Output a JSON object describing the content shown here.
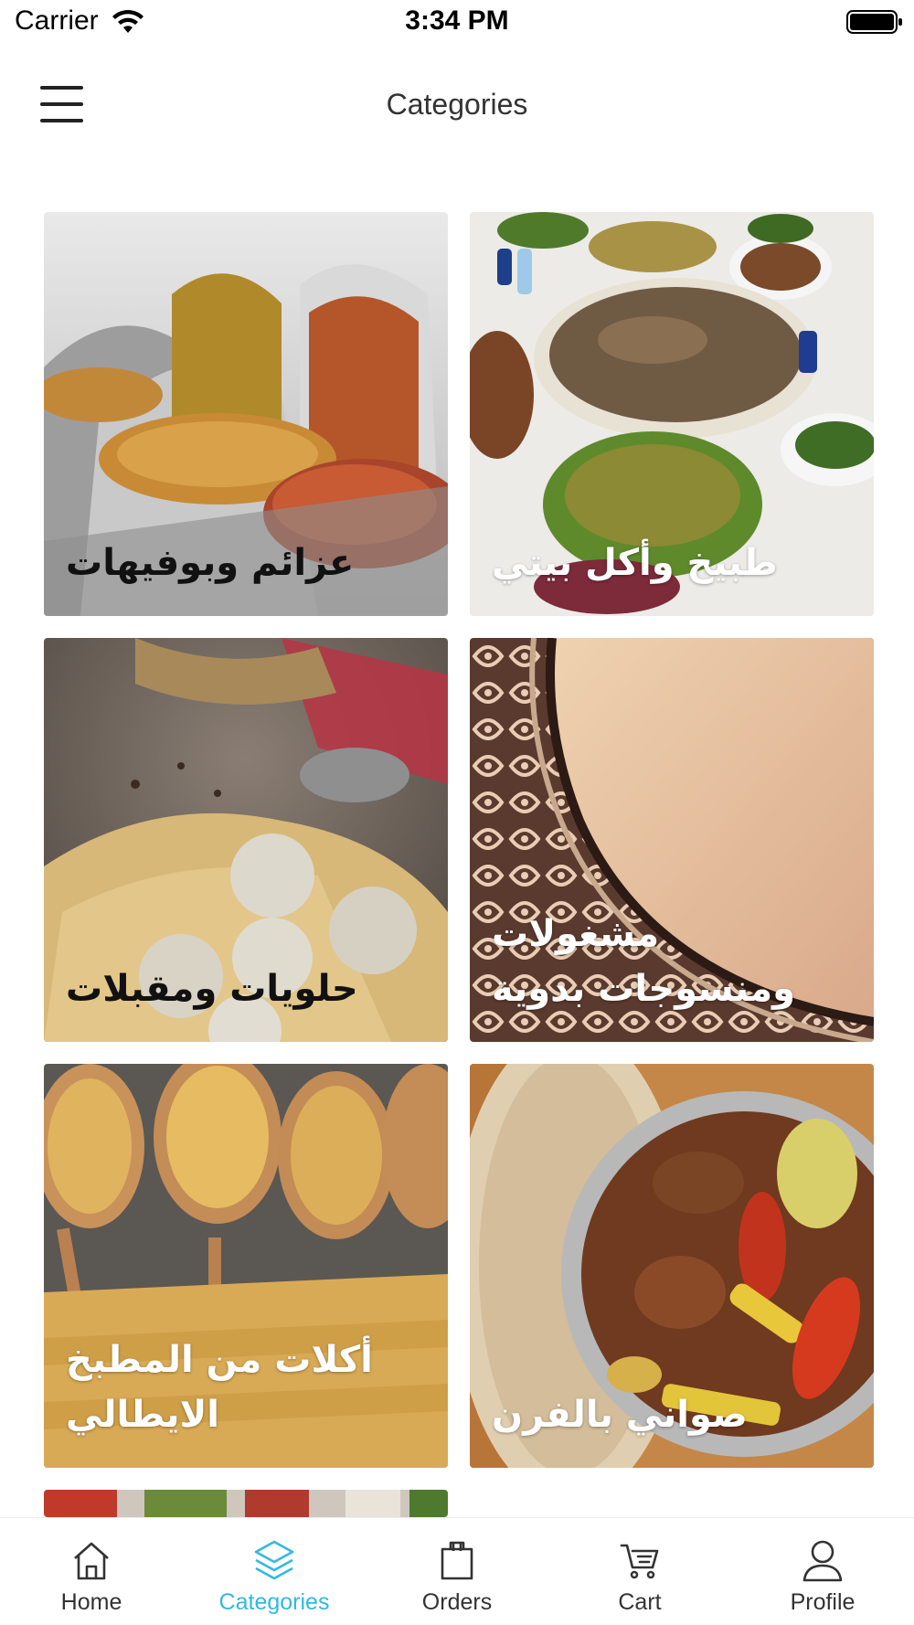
{
  "status_bar": {
    "carrier": "Carrier",
    "time": "3:34 PM"
  },
  "nav": {
    "title": "Categories",
    "menu_icon": "hamburger-menu-icon"
  },
  "categories": [
    {
      "label": "عزائم وبوفيهات",
      "label_style": "dark",
      "image": "buffet-chafing-dishes"
    },
    {
      "label": "طبيخ وأكل بيتي",
      "label_style": "light",
      "image": "home-cooked-feast-table"
    },
    {
      "label": "حلويات ومقبلات",
      "label_style": "dark",
      "image": "sweets-coconut-balls"
    },
    {
      "label": "مشغولات ومنسوجات بدوية",
      "label_style": "light",
      "image": "bedouin-ornamental-pattern"
    },
    {
      "label": "أكلات من المطبخ الايطالي",
      "label_style": "light",
      "image": "italian-pasta-spoons"
    },
    {
      "label": "صواني بالفرن",
      "label_style": "light",
      "image": "oven-tray-meat-vegetables"
    }
  ],
  "tabs": [
    {
      "label": "Home",
      "icon": "home-icon",
      "active": false
    },
    {
      "label": "Categories",
      "icon": "layers-icon",
      "active": true
    },
    {
      "label": "Orders",
      "icon": "shopping-bag-icon",
      "active": false
    },
    {
      "label": "Cart",
      "icon": "cart-icon",
      "active": false
    },
    {
      "label": "Profile",
      "icon": "user-icon",
      "active": false
    }
  ],
  "colors": {
    "accent": "#34b8e0",
    "tab_inactive": "#333333"
  }
}
